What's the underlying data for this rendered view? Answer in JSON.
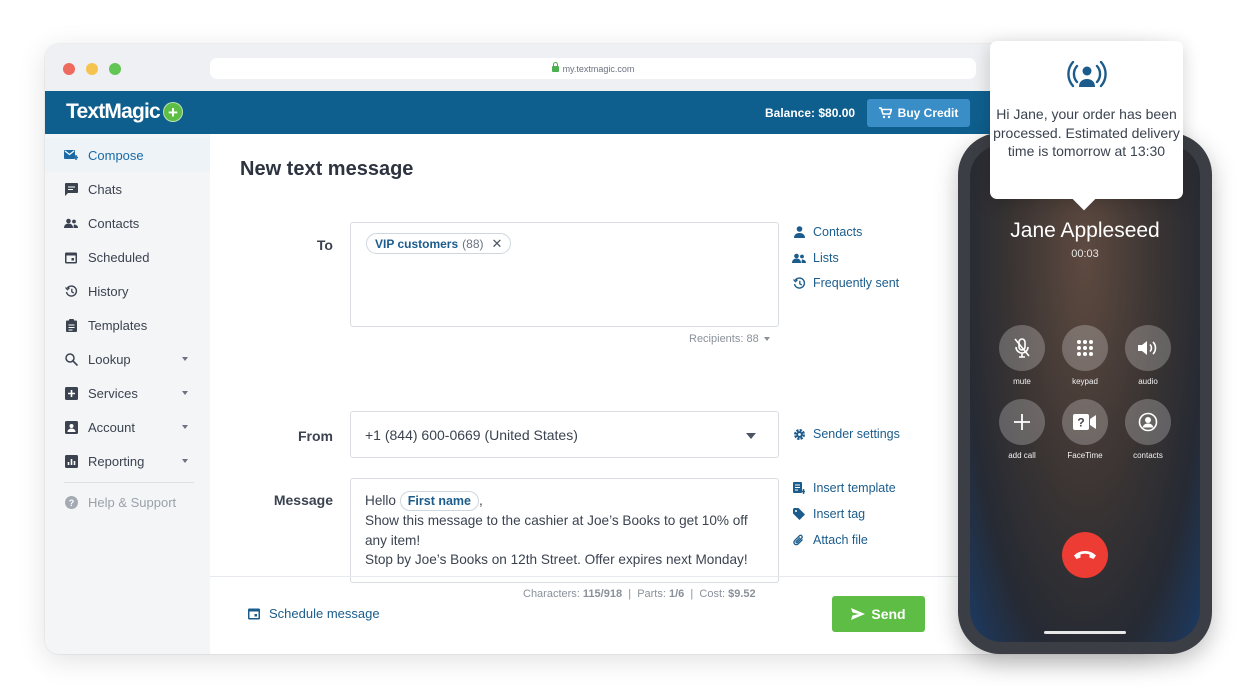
{
  "browser": {
    "url": "my.textmagic.com"
  },
  "app": {
    "logo": "TextMagic",
    "balance": "Balance: $80.00",
    "buy_credit": "Buy Credit",
    "colors": {
      "brand": "#0f5f8e",
      "accent": "#5ebd45",
      "link": "#1b5c8c"
    }
  },
  "sidebar": {
    "items": [
      {
        "label": "Compose",
        "icon": "compose-icon"
      },
      {
        "label": "Chats",
        "icon": "chat-icon"
      },
      {
        "label": "Contacts",
        "icon": "contacts-icon"
      },
      {
        "label": "Scheduled",
        "icon": "calendar-icon"
      },
      {
        "label": "History",
        "icon": "history-icon"
      },
      {
        "label": "Templates",
        "icon": "clipboard-icon"
      },
      {
        "label": "Lookup",
        "icon": "search-icon"
      },
      {
        "label": "Services",
        "icon": "services-icon"
      },
      {
        "label": "Account",
        "icon": "account-icon"
      },
      {
        "label": "Reporting",
        "icon": "chart-icon"
      },
      {
        "label": "Help & Support",
        "icon": "help-icon"
      }
    ]
  },
  "compose": {
    "title": "New text message",
    "to_label": "To",
    "to_chip": {
      "name": "VIP customers",
      "count": "(88)"
    },
    "recipients": "Recipients: 88",
    "to_links": [
      "Contacts",
      "Lists",
      "Frequently sent"
    ],
    "from_label": "From",
    "from_value": "+1 (844) 600-0669 (United States)",
    "sender_settings": "Sender settings",
    "message_label": "Message",
    "message": {
      "greeting": "Hello",
      "tag": "First name",
      "comma": ",",
      "line2": "Show this message to the cashier at Joe’s Books to get 10% off any item!",
      "line3": "Stop by Joe’s Books on 12th Street. Offer expires next Monday!"
    },
    "message_links": [
      "Insert template",
      "Insert tag",
      "Attach file"
    ],
    "stats": {
      "characters_label": "Characters:",
      "characters": "115/918",
      "parts_label": "Parts:",
      "parts": "1/6",
      "cost_label": "Cost:",
      "cost": "$9.52",
      "sep": "|"
    },
    "schedule": "Schedule message",
    "send": "Send"
  },
  "phone": {
    "caller": "Jane Appleseed",
    "timer": "00:03",
    "buttons": [
      "mute",
      "keypad",
      "audio",
      "add call",
      "FaceTime",
      "contacts"
    ]
  },
  "notification": {
    "text": "Hi Jane, your order has been processed. Estimated delivery time is tomorrow at 13:30"
  }
}
